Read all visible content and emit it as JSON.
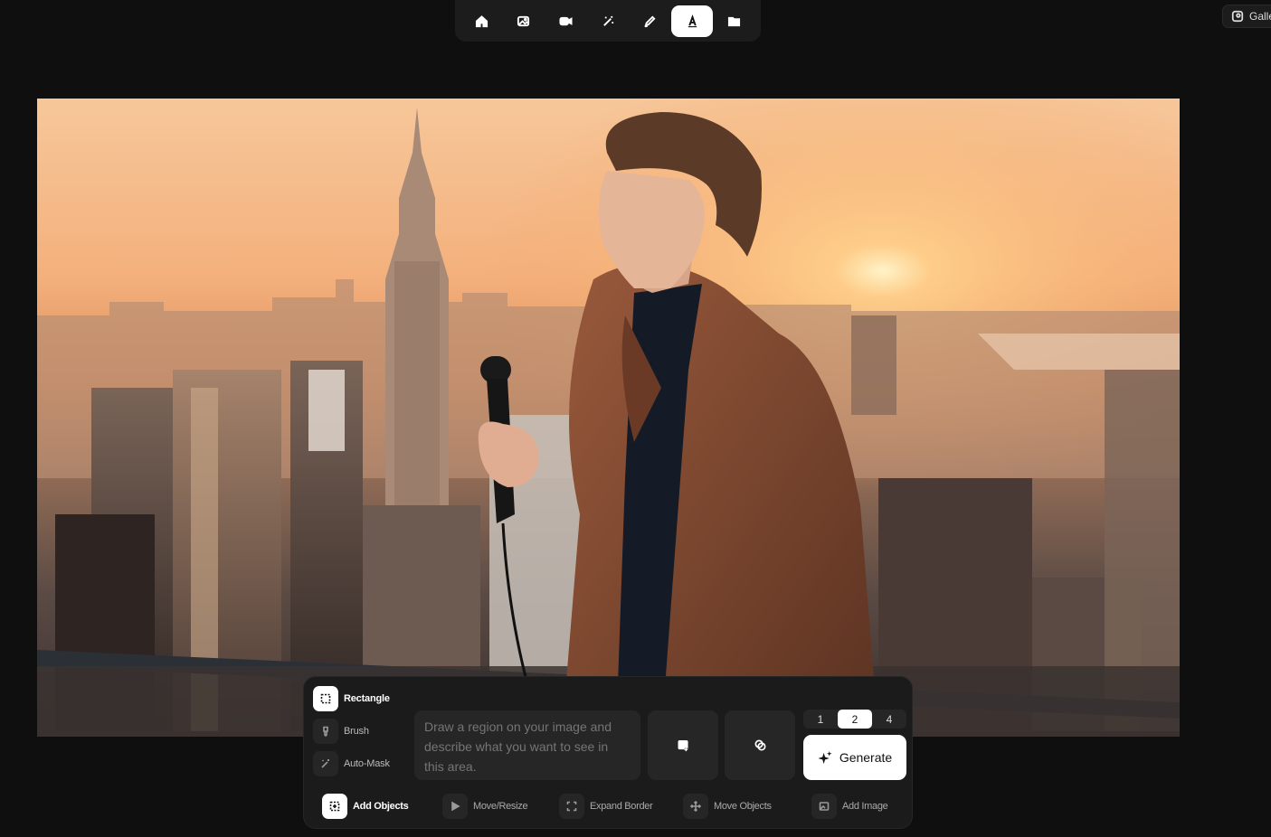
{
  "toolbar": {
    "tools": [
      {
        "icon": "home-icon"
      },
      {
        "icon": "image-icon"
      },
      {
        "icon": "video-icon"
      },
      {
        "icon": "magic-wand-icon"
      },
      {
        "icon": "brush-pen-icon"
      },
      {
        "icon": "text-edit-icon",
        "active": true
      },
      {
        "icon": "folder-icon"
      }
    ]
  },
  "gallery": {
    "label": "Galle"
  },
  "panel": {
    "modes": [
      {
        "label": "Rectangle",
        "icon": "rectangle-select-icon",
        "active": true
      },
      {
        "label": "Brush",
        "icon": "brush-icon"
      },
      {
        "label": "Auto-Mask",
        "icon": "auto-mask-icon"
      }
    ],
    "prompt_placeholder": "Draw a region on your image and describe what you want to see in this area.",
    "add_reference_icon": "add-image-reference-icon",
    "link_icon": "link-icon",
    "counts": [
      "1",
      "2",
      "4"
    ],
    "selected_count": "2",
    "generate_label": "Generate",
    "tabs": [
      {
        "label": "Add Objects",
        "icon": "add-objects-icon",
        "active": true
      },
      {
        "label": "Move/Resize",
        "icon": "cursor-icon"
      },
      {
        "label": "Expand Border",
        "icon": "expand-icon"
      },
      {
        "label": "Move Objects",
        "icon": "move-icon"
      },
      {
        "label": "Add Image",
        "icon": "add-image-icon"
      }
    ]
  },
  "colors": {
    "accent": "#ffffff",
    "background": "#0f0f0f",
    "panel": "#1b1b1b"
  }
}
